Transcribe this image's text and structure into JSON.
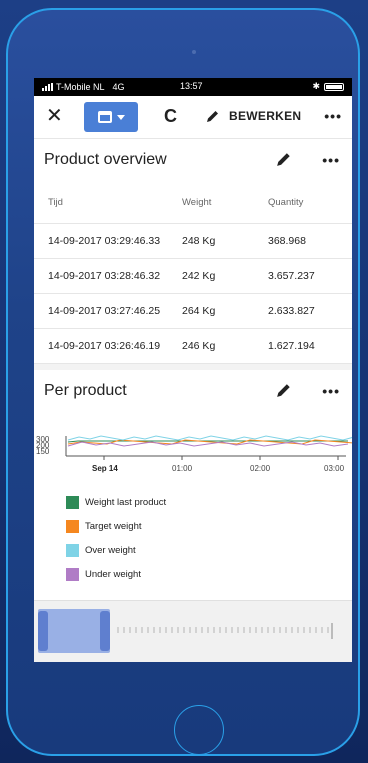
{
  "status": {
    "carrier": "T-Mobile NL",
    "network": "4G",
    "time": "13:57"
  },
  "toolbar": {
    "close_label": "✕",
    "refresh_label": "C",
    "edit_label": "BEWERKEN",
    "more_label": "•••"
  },
  "overview": {
    "title": "Product overview",
    "more_label": "•••",
    "columns": [
      "Tijd",
      "Weight",
      "Quantity"
    ],
    "rows": [
      [
        "14-09-2017 03:29:46.33",
        "248 Kg",
        "368.968"
      ],
      [
        "14-09-2017 03:28:46.32",
        "242 Kg",
        "3.657.237"
      ],
      [
        "14-09-2017 03:27:46.25",
        "264 Kg",
        "2.633.827"
      ],
      [
        "14-09-2017 03:26:46.19",
        "246 Kg",
        "1.627.194"
      ]
    ]
  },
  "per_product": {
    "title": "Per product",
    "more_label": "•••",
    "y_ticks": [
      "300",
      "200",
      "150"
    ],
    "x_ticks": [
      "Sep 14",
      "01:00",
      "02:00",
      "03:00"
    ],
    "legend": [
      {
        "label": "Weight last product",
        "color": "#2e8b57"
      },
      {
        "label": "Target weight",
        "color": "#f5871f"
      },
      {
        "label": "Over weight",
        "color": "#7fd3e6"
      },
      {
        "label": "Under weight",
        "color": "#b07cc6"
      }
    ]
  },
  "colors": {
    "accent": "#4a7fd6",
    "phone_frame": "#2aa0e8"
  }
}
